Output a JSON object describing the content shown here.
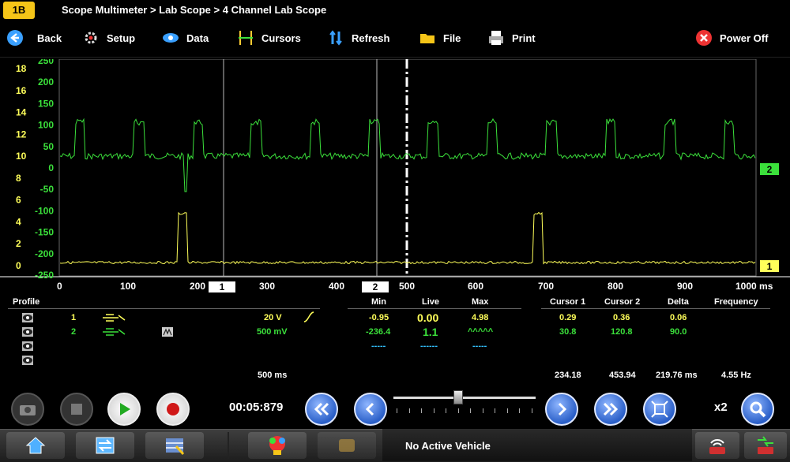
{
  "title": {
    "logo_text": "1B",
    "breadcrumb": "Scope Multimeter > Lab Scope > 4 Channel Lab Scope"
  },
  "toolbar": {
    "back": "Back",
    "setup": "Setup",
    "data": "Data",
    "cursors": "Cursors",
    "refresh": "Refresh",
    "file": "File",
    "print": "Print",
    "power_off": "Power Off"
  },
  "plot": {
    "left_scale_ch1": [
      "18",
      "16",
      "14",
      "12",
      "10",
      "8",
      "6",
      "4",
      "2",
      "0"
    ],
    "left_scale_ch2": [
      "250",
      "200",
      "150",
      "100",
      "50",
      "0",
      "-50",
      "-100",
      "-150",
      "-200",
      "-250"
    ],
    "channel_markers": [
      "2",
      "1"
    ],
    "cursor_labels": [
      "1",
      "2"
    ],
    "x_ticks": [
      "0",
      "100",
      "200",
      "300",
      "400",
      "500",
      "600",
      "700",
      "800",
      "900",
      "1000 ms"
    ],
    "colors": {
      "ch1": "#ffff5a",
      "ch2": "#3be03b",
      "grid": "#555555"
    }
  },
  "profile": {
    "header": "Profile",
    "rows": [
      {
        "num": "1",
        "scale": "20 V",
        "min": "-0.95",
        "live": "0.00",
        "max": "4.98",
        "cursor1": "0.29",
        "cursor2": "0.36",
        "delta": "0.06"
      },
      {
        "num": "2",
        "scale": "500 mV",
        "min": "-236.4",
        "live": "1.1",
        "max": "^^^^^",
        "cursor1": "30.8",
        "cursor2": "120.8",
        "delta": "90.0"
      },
      {
        "min": "-----",
        "live": "------",
        "max": "-----"
      }
    ],
    "col_min": "Min",
    "col_live": "Live",
    "col_max": "Max",
    "col_cursor1": "Cursor 1",
    "col_cursor2": "Cursor 2",
    "col_delta": "Delta",
    "col_frequency": "Frequency",
    "timebase": "500 ms",
    "cursor1_time": "234.18",
    "cursor2_time": "453.94",
    "delta_time": "219.76 ms",
    "frequency": "4.55 Hz"
  },
  "controls": {
    "elapsed": "00:05:879",
    "zoom": "x2",
    "slider_position": 0.45
  },
  "bottombar": {
    "vehicle_status": "No Active Vehicle"
  }
}
